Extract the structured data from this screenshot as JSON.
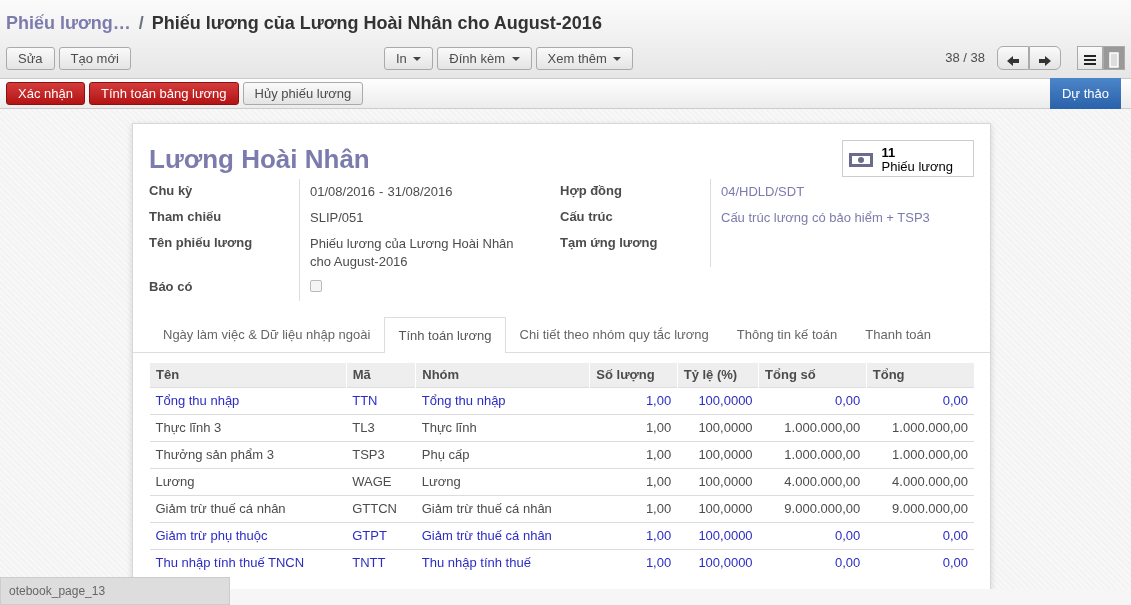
{
  "breadcrumb": {
    "parent": "Phiếu lương…",
    "separator": "/",
    "current": "Phiếu lương của Lương Hoài Nhân cho August-2016"
  },
  "toolbar": {
    "left_buttons": [
      "Sửa",
      "Tạo mới"
    ],
    "dropdowns": [
      "In",
      "Đính kèm",
      "Xem thêm"
    ],
    "pager": "38 / 38",
    "views": [
      {
        "kind": "list",
        "selected": false
      },
      {
        "kind": "form",
        "selected": true
      }
    ]
  },
  "actions": [
    {
      "label": "Xác nhận",
      "kind": "primary"
    },
    {
      "label": "Tính toán bảng lương",
      "kind": "primary"
    },
    {
      "label": "Hủy phiếu lương",
      "kind": "default"
    }
  ],
  "status": {
    "label": "Dự thảo",
    "selected": true
  },
  "sheet": {
    "title": "Lương Hoài Nhân",
    "smart_button": {
      "count": "11",
      "label": "Phiếu lương"
    },
    "left_fields": [
      {
        "label": "Chu kỳ",
        "kind": "range",
        "from": "01/08/2016",
        "sep": "-",
        "to": "31/08/2016"
      },
      {
        "label": "Tham chiếu",
        "kind": "text",
        "value": "SLIP/051"
      },
      {
        "label": "Tên phiếu lương",
        "kind": "text",
        "value": "Phiếu lương của Lương Hoài Nhân cho August-2016"
      },
      {
        "label": "Báo có",
        "kind": "checkbox",
        "checked": false
      }
    ],
    "right_fields": [
      {
        "label": "Hợp đồng",
        "kind": "link",
        "value": "04/HDLD/SDT"
      },
      {
        "label": "Cấu trúc",
        "kind": "link",
        "value": "Cấu trúc lương có bảo hiểm + TSP3"
      },
      {
        "label": "Tạm ứng lương",
        "kind": "text"
      }
    ],
    "tabs": [
      {
        "label": "Ngày làm việc & Dữ liệu nhập ngoài",
        "selected": false
      },
      {
        "label": "Tính toán lương",
        "selected": true
      },
      {
        "label": "Chi tiết theo nhóm quy tắc lương",
        "selected": false
      },
      {
        "label": "Thông tin kế toán",
        "selected": false
      },
      {
        "label": "Thanh toán",
        "selected": false
      }
    ],
    "table": {
      "columns": [
        "Tên",
        "Mã",
        "Nhóm",
        "Số lượng",
        "Tỷ lệ (%)",
        "Tổng số",
        "Tổng"
      ],
      "rows": [
        {
          "kind": "link",
          "cells": [
            "Tổng thu nhập",
            "TTN",
            "Tổng thu nhập",
            "1,00",
            "100,0000",
            "0,00",
            "0,00"
          ]
        },
        {
          "kind": "plain",
          "cells": [
            "Thực lĩnh 3",
            "TL3",
            "Thực lĩnh",
            "1,00",
            "100,0000",
            "1.000.000,00",
            "1.000.000,00"
          ]
        },
        {
          "kind": "plain",
          "cells": [
            "Thưởng sản phẩm 3",
            "TSP3",
            "Phụ cấp",
            "1,00",
            "100,0000",
            "1.000.000,00",
            "1.000.000,00"
          ]
        },
        {
          "kind": "plain",
          "cells": [
            "Lương",
            "WAGE",
            "Lương",
            "1,00",
            "100,0000",
            "4.000.000,00",
            "4.000.000,00"
          ]
        },
        {
          "kind": "plain",
          "cells": [
            "Giảm trừ thuế cá nhân",
            "GTTCN",
            "Giảm trừ thuế cá nhân",
            "1,00",
            "100,0000",
            "9.000.000,00",
            "9.000.000,00"
          ]
        },
        {
          "kind": "link",
          "cells": [
            "Giảm trừ phụ thuộc",
            "GTPT",
            "Giảm trừ thuế cá nhân",
            "1,00",
            "100,0000",
            "0,00",
            "0,00"
          ]
        },
        {
          "kind": "link",
          "cells": [
            "Thu nhập tính thuế TNCN",
            "TNTT",
            "Thu nhập tính thuế",
            "1,00",
            "100,0000",
            "0,00",
            "0,00"
          ]
        }
      ]
    }
  },
  "status_tooltip": "otebook_page_13"
}
